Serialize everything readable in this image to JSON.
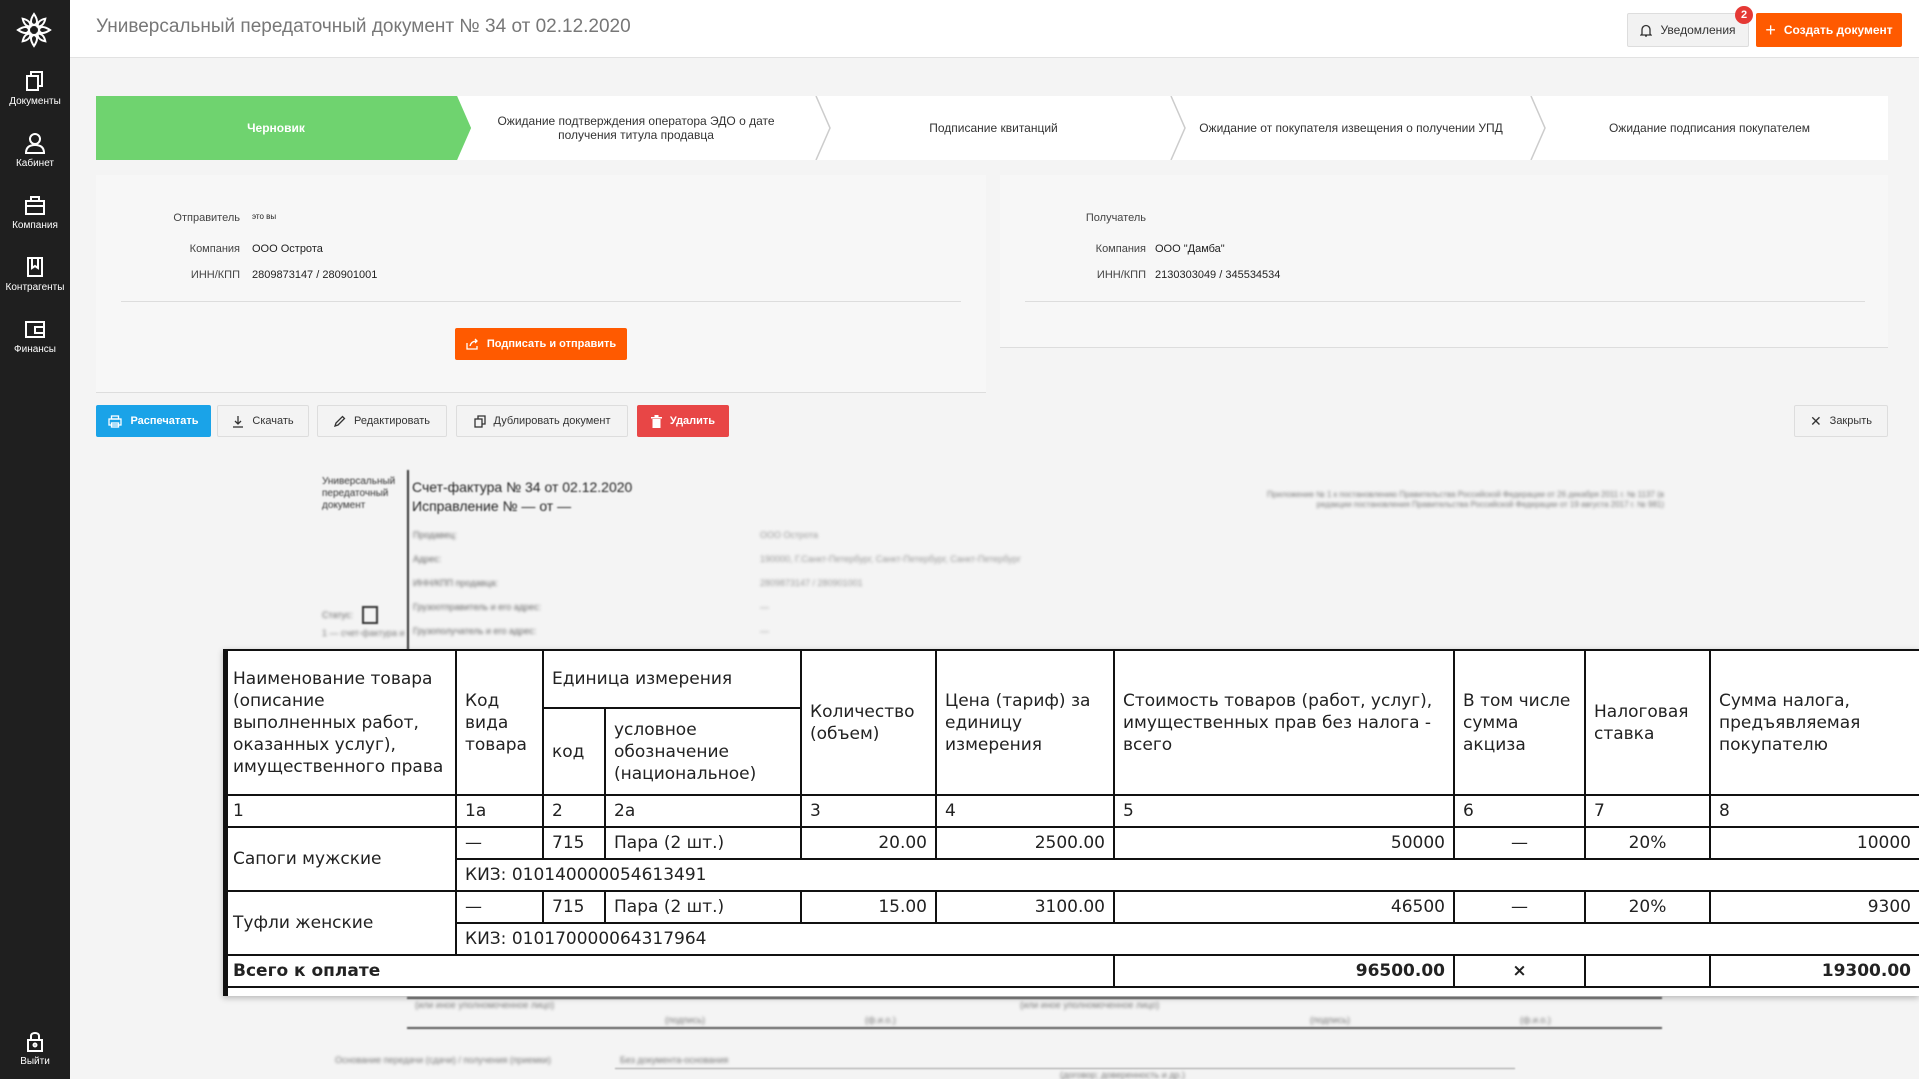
{
  "sidebar": {
    "items": [
      {
        "label": "Документы",
        "icon": "documents-icon"
      },
      {
        "label": "Кабинет",
        "icon": "user-icon"
      },
      {
        "label": "Компания",
        "icon": "briefcase-icon"
      },
      {
        "label": "Контрагенты",
        "icon": "contacts-icon"
      },
      {
        "label": "Финансы",
        "icon": "wallet-icon"
      }
    ],
    "logout": "Выйти"
  },
  "header": {
    "title": "Универсальный передаточный документ № 34 от 02.12.2020",
    "notifications_label": "Уведомления",
    "notifications_count": "2",
    "create_label": "Создать документ"
  },
  "stepper": [
    "Черновик",
    "Ожидание подтверждения оператора ЭДО о дате получения титула продавца",
    "Подписание квитанций",
    "Ожидание от покупателя извещения о получении УПД",
    "Ожидание подписания покупателем"
  ],
  "sender": {
    "label": "Отправитель",
    "note": "это вы",
    "company_label": "Компания",
    "company": "ООО Острота",
    "inn_label": "ИНН/КПП",
    "inn": "2809873147 / 280901001",
    "sign_button": "Подписать и отправить"
  },
  "receiver": {
    "label": "Получатель",
    "company_label": "Компания",
    "company": "ООО \"Дамба\"",
    "inn_label": "ИНН/КПП",
    "inn": "2130303049 / 345534534"
  },
  "toolbar": {
    "print": "Распечатать",
    "download": "Скачать",
    "edit": "Редактировать",
    "duplicate": "Дублировать документ",
    "delete": "Удалить",
    "close": "Закрыть"
  },
  "document": {
    "side_label": "Универсальный передаточный документ",
    "invoice_line": "Счет-фактура №  34  от  02.12.2020",
    "correction_line": "Исправление №  —  от  —",
    "appendix": "Приложение № 1 к постановлению Правительства Российской Федерации от 26 декабря 2011 г. № 1137 (в редакции постановления Правительства Российской Федерации от 19 августа 2017 г. № 981)",
    "fields": [
      {
        "label": "Продавец:",
        "value": "ООО Острота"
      },
      {
        "label": "Адрес:",
        "value": "190000, Г.Санкт-Петербург, Санкт-Петербург, Санкт-Петербург"
      },
      {
        "label": "ИНН/КПП продавца:",
        "value": "2809873147 / 280901001"
      },
      {
        "label": "Грузоотправитель и его адрес:",
        "value": "—"
      },
      {
        "label": "Грузополучатель и его адрес:",
        "value": "—"
      }
    ],
    "status_label": "Статус:",
    "status_value": "1",
    "status_hint": "1 — счет-фактура и",
    "sig_captions": [
      "(или иное уполномоченное лицо)",
      "(подпись)",
      "(ф.и.о.)",
      "(или иное уполномоченное лицо)",
      "(подпись)",
      "(ф.и.о.)"
    ],
    "basis_label": "Основание передачи (сдачи) / получения (приемки)",
    "basis_value": "Без документа-основания",
    "bottom_caption": "(договор; доверенность и др.)"
  },
  "invoice_table": {
    "headers": {
      "name": "Наименование товара (описание выполненных работ, оказанных услуг), имущественного права",
      "kind_code": "Код вида товара",
      "unit": "Единица измерения",
      "unit_code": "код",
      "unit_name": "условное обозначение (национальное)",
      "qty": "Количество (объем)",
      "price": "Цена (тариф) за единицу измерения",
      "cost": "Стоимость товаров (работ, услуг), имущественных прав без налога - всего",
      "excise": "В том числе сумма акциза",
      "rate": "Налоговая ставка",
      "tax": "Сумма налога, предъявляемая покупателю"
    },
    "numbers": [
      "1",
      "1а",
      "2",
      "2а",
      "3",
      "4",
      "5",
      "6",
      "7",
      "8"
    ],
    "rows": [
      {
        "name": "Сапоги мужские",
        "kind": "—",
        "code": "715",
        "unit": "Пара (2 шт.)",
        "qty": "20.00",
        "price": "2500.00",
        "cost": "50000",
        "excise": "—",
        "rate": "20%",
        "tax": "10000",
        "kiz": "КИЗ: 010140000054613491"
      },
      {
        "name": "Туфли женские",
        "kind": "—",
        "code": "715",
        "unit": "Пара (2 шт.)",
        "qty": "15.00",
        "price": "3100.00",
        "cost": "46500",
        "excise": "—",
        "rate": "20%",
        "tax": "9300",
        "kiz": "КИЗ: 010170000064317964"
      }
    ],
    "total_label": "Всего к оплате",
    "total_cost": "96500.00",
    "total_excise": "×",
    "total_tax": "19300.00"
  }
}
